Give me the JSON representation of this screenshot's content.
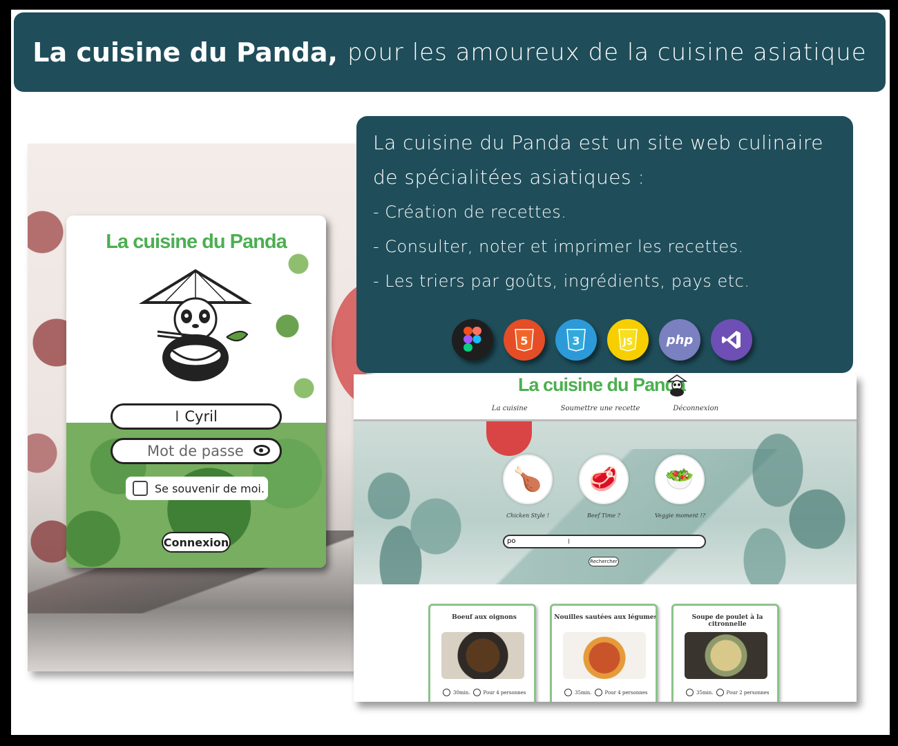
{
  "header": {
    "title_bold": "La cuisine du Panda,",
    "title_rest": "pour les amoureux de la cuisine asiatique"
  },
  "description": {
    "intro": "La cuisine du Panda est un site web culinaire de spécialitées asiatiques :",
    "features": [
      "- Création de recettes.",
      "- Consulter, noter et imprimer les recettes.",
      "- Les triers par goûts, ingrédients, pays etc."
    ],
    "technologies": [
      {
        "name": "figma-icon",
        "label": "Figma",
        "color": "#1e1e1e"
      },
      {
        "name": "html5-icon",
        "label": "5",
        "color": "#e44d26"
      },
      {
        "name": "css3-icon",
        "label": "3",
        "color": "#2c9ad8"
      },
      {
        "name": "javascript-icon",
        "label": "JS",
        "color": "#f7ce00"
      },
      {
        "name": "php-icon",
        "label": "php",
        "color": "#7b80c0"
      },
      {
        "name": "visual-studio-icon",
        "label": "VS",
        "color": "#6e4fb5"
      }
    ]
  },
  "login": {
    "title": "La cuisine du Panda",
    "username_value": "Cyril",
    "password_placeholder": "Mot de passe",
    "remember_label": "Se souvenir de moi.",
    "submit_label": "Connexion"
  },
  "site": {
    "logo": "La cuisine du Panda",
    "nav": [
      "La cuisine",
      "Soumettre une recette",
      "Déconnexion"
    ],
    "categories": [
      {
        "label": "Chicken Style !",
        "icon": "chicken-bowl-icon"
      },
      {
        "label": "Beef Time ?",
        "icon": "beef-icon"
      },
      {
        "label": "Veggie moment !?",
        "icon": "veggie-bowl-icon"
      }
    ],
    "search_value": "po",
    "search_button": "Rechercher",
    "recipes": [
      {
        "title": "Boeuf aux oignons",
        "time": "30min.",
        "servings": "Pour 4 personnes"
      },
      {
        "title": "Nouilles sautées aux légumes",
        "time": "35min.",
        "servings": "Pour 4 personnes"
      },
      {
        "title": "Soupe de poulet à la citronnelle",
        "time": "35min.",
        "servings": "Pour 2 personnes"
      }
    ]
  }
}
